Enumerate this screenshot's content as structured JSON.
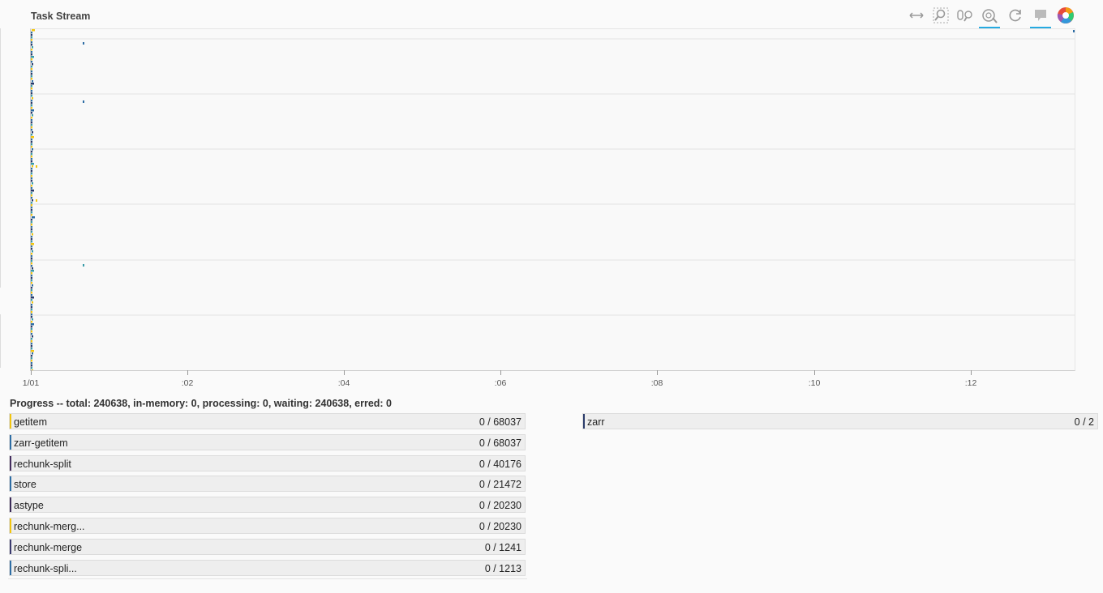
{
  "task_stream": {
    "title": "Task Stream",
    "toolbar": [
      {
        "icon": "xpan-icon",
        "active": true
      },
      {
        "icon": "box-zoom-icon",
        "active": false
      },
      {
        "icon": "wheel-zoom-icon",
        "active": false
      },
      {
        "icon": "tap-icon",
        "active": true
      },
      {
        "icon": "reset-icon",
        "active": false
      },
      {
        "icon": "hover-icon",
        "active": true
      },
      {
        "icon": "bokeh-logo-icon",
        "active": false
      }
    ],
    "x_ticks": [
      "1/01",
      ":02",
      ":04",
      ":06",
      ":08",
      ":10",
      ":12"
    ],
    "colors": {
      "yellow": "#f1c40f",
      "blue": "#2e6da4",
      "navy": "#2a3b6a",
      "teal": "#3a9ca8"
    }
  },
  "progress": {
    "title": "Progress -- total: 240638, in-memory: 0, processing: 0, waiting: 240638, erred: 0",
    "left_items": [
      {
        "name": "getitem",
        "count": "0 / 68037",
        "color": "#f1c40f"
      },
      {
        "name": "zarr-getitem",
        "count": "0 / 68037",
        "color": "#2e6da4"
      },
      {
        "name": "rechunk-split",
        "count": "0 / 40176",
        "color": "#442d5e"
      },
      {
        "name": "store",
        "count": "0 / 21472",
        "color": "#2e6da4"
      },
      {
        "name": "astype",
        "count": "0 / 20230",
        "color": "#3b2b58"
      },
      {
        "name": "rechunk-merg...",
        "count": "0 / 20230",
        "color": "#f1c40f"
      },
      {
        "name": "rechunk-merge",
        "count": "0 / 1241",
        "color": "#3a3a6e"
      },
      {
        "name": "rechunk-spli...",
        "count": "0 / 1213",
        "color": "#2e6da4"
      }
    ],
    "right_items": [
      {
        "name": "zarr",
        "count": "0 / 2",
        "color": "#2a3b6a"
      }
    ]
  }
}
